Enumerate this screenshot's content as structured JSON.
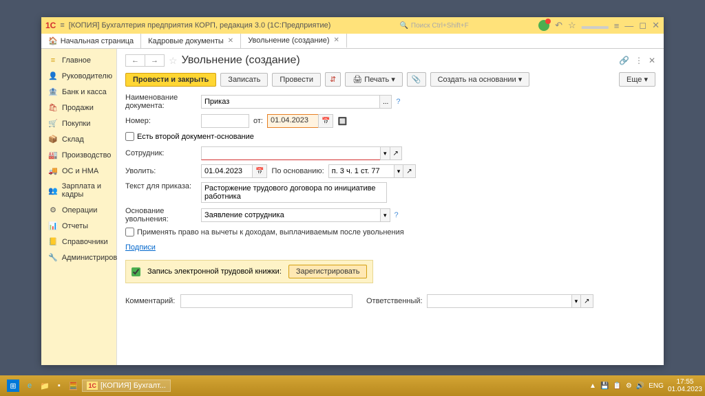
{
  "titlebar": {
    "logo": "1C",
    "title": "[КОПИЯ] Бухгалтерия предприятия КОРП, редакция 3.0  (1С:Предприятие)",
    "search_placeholder": "Поиск Ctrl+Shift+F"
  },
  "tabs": [
    {
      "label": "Начальная страница",
      "closable": false,
      "home": true
    },
    {
      "label": "Кадровые документы",
      "closable": true
    },
    {
      "label": "Увольнение (создание)",
      "closable": true,
      "active": true
    }
  ],
  "sidebar": [
    {
      "icon": "≡",
      "label": "Главное",
      "color": "#d4a010"
    },
    {
      "icon": "👤",
      "label": "Руководителю",
      "color": "#8e44ad"
    },
    {
      "icon": "🏦",
      "label": "Банк и касса",
      "color": "#d4a010"
    },
    {
      "icon": "🛍",
      "label": "Продажи",
      "color": "#c0392b"
    },
    {
      "icon": "🛒",
      "label": "Покупки",
      "color": "#2c3e50"
    },
    {
      "icon": "📦",
      "label": "Склад",
      "color": "#27ae60"
    },
    {
      "icon": "🏭",
      "label": "Производство",
      "color": "#555"
    },
    {
      "icon": "🚚",
      "label": "ОС и НМА",
      "color": "#555"
    },
    {
      "icon": "👥",
      "label": "Зарплата и кадры",
      "color": "#2980b9"
    },
    {
      "icon": "⚙",
      "label": "Операции",
      "color": "#555"
    },
    {
      "icon": "📊",
      "label": "Отчеты",
      "color": "#2980b9"
    },
    {
      "icon": "📒",
      "label": "Справочники",
      "color": "#d4a010"
    },
    {
      "icon": "🔧",
      "label": "Администрирование",
      "color": "#555"
    }
  ],
  "page": {
    "title": "Увольнение (создание)",
    "toolbar": {
      "primary": "Провести и закрыть",
      "write": "Записать",
      "post": "Провести",
      "print": "Печать",
      "create_based": "Создать на основании",
      "more": "Еще"
    },
    "labels": {
      "doc_name": "Наименование документа:",
      "number": "Номер:",
      "ot": "от:",
      "second_doc": "Есть второй документ-основание",
      "employee": "Сотрудник:",
      "dismiss": "Уволить:",
      "by_reason": "По основанию:",
      "order_text": "Текст для приказа:",
      "dismiss_reason": "Основание увольнения:",
      "apply_deduction": "Применять право на вычеты к доходам, выплачиваемым после увольнения",
      "signatures": "Подписи",
      "etk_label": "Запись электронной трудовой книжки:",
      "register": "Зарегистрировать",
      "comment": "Комментарий:",
      "responsible": "Ответственный:"
    },
    "values": {
      "doc_name": "Приказ",
      "number": "",
      "date_from": "01.04.2023",
      "employee": "",
      "dismiss_date": "01.04.2023",
      "reason_article": "п. 3 ч. 1 ст. 77",
      "order_text": "Расторжение трудового договора по инициативе работника",
      "dismiss_reason": "Заявление сотрудника",
      "comment": "",
      "responsible": ""
    }
  },
  "taskbar": {
    "app": "[КОПИЯ] Бухгалт...",
    "lang": "ENG",
    "time": "17:55",
    "date": "01.04.2023"
  }
}
